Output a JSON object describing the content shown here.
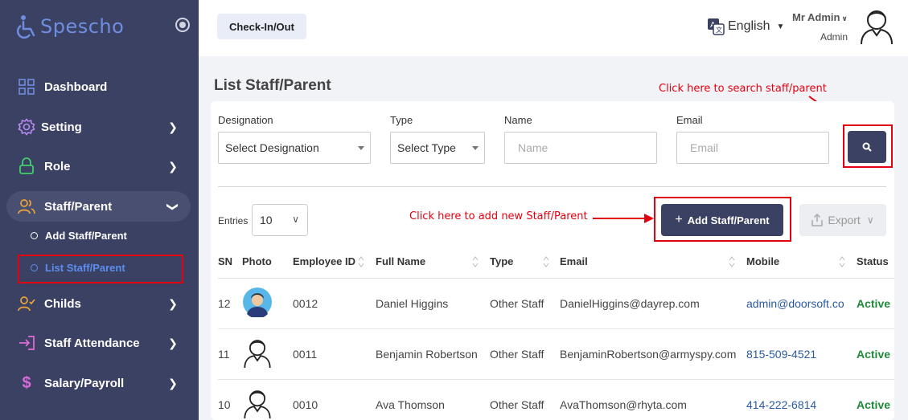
{
  "sidebar": {
    "logo_text": "Spescho",
    "items": [
      {
        "label": "Dashboard",
        "icon": "dashboard-grid-icon",
        "has_chevron": false
      },
      {
        "label": "Setting",
        "icon": "gear-icon",
        "has_chevron": true
      },
      {
        "label": "Role",
        "icon": "lock-icon",
        "has_chevron": true
      },
      {
        "label": "Staff/Parent",
        "icon": "users-icon",
        "has_chevron": true,
        "expanded": true
      },
      {
        "label": "Childs",
        "icon": "user-check-icon",
        "has_chevron": true
      },
      {
        "label": "Staff Attendance",
        "icon": "login-arrow-icon",
        "has_chevron": true
      },
      {
        "label": "Salary/Payroll",
        "icon": "dollar-icon",
        "has_chevron": true
      }
    ],
    "sub_items": [
      {
        "label": "Add Staff/Parent"
      },
      {
        "label": "List Staff/Parent",
        "current": true
      }
    ]
  },
  "topbar": {
    "checkin_label": "Check-In/Out",
    "language": "English",
    "user_name": "Mr Admin",
    "user_role": "Admin"
  },
  "page": {
    "title": "List Staff/Parent"
  },
  "filters": {
    "designation": {
      "label": "Designation",
      "value": "Select Designation"
    },
    "type": {
      "label": "Type",
      "value": "Select Type"
    },
    "name": {
      "label": "Name",
      "placeholder": "Name"
    },
    "email": {
      "label": "Email",
      "placeholder": "Email"
    }
  },
  "list_controls": {
    "entries_label": "Entries",
    "entries_value": "10",
    "add_label": "Add Staff/Parent",
    "export_label": "Export"
  },
  "annotations": {
    "search_hint": "Click here to search staff/parent",
    "add_hint": "Click here to add new Staff/Parent"
  },
  "table": {
    "headers": [
      "SN",
      "Photo",
      "Employee ID",
      "Full Name",
      "Type",
      "Email",
      "Mobile",
      "Status"
    ],
    "rows": [
      {
        "sn": "12",
        "photo": "photo-avatar",
        "employee_id": "0012",
        "full_name": "Daniel Higgins",
        "type": "Other Staff",
        "email": "DanielHiggins@dayrep.com",
        "mobile": "admin@doorsoft.co",
        "status": "Active"
      },
      {
        "sn": "11",
        "photo": "outline-avatar",
        "employee_id": "0011",
        "full_name": "Benjamin Robertson",
        "type": "Other Staff",
        "email": "BenjaminRobertson@armyspy.com",
        "mobile": "815-509-4521",
        "status": "Active"
      },
      {
        "sn": "10",
        "photo": "outline-avatar",
        "employee_id": "0010",
        "full_name": "Ava Thomson",
        "type": "Other Staff",
        "email": "AvaThomson@rhyta.com",
        "mobile": "414-222-6814",
        "status": "Active"
      }
    ]
  },
  "colors": {
    "sidebar_bg": "#3a4163",
    "accent_blue": "#5d8dee",
    "annotation_red": "#e3000f",
    "status_green": "#1f8a3a"
  }
}
